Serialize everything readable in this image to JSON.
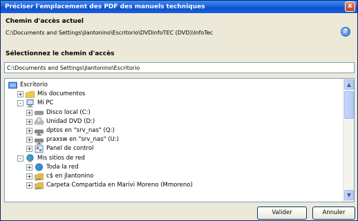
{
  "window": {
    "title": "Préciser l'emplacement des PDF des manuels techniques",
    "close_label": "x"
  },
  "current_path": {
    "label": "Chemin d'accès actuel",
    "value": "C:\\Documents and Settings\\jlantonino\\Escritorio\\DVDinfoTEC (DVD)\\InfoTec"
  },
  "select_path": {
    "label": "Sélectionnez le chemin d'accès",
    "value": "C:\\Documents and Settings\\jlantonino\\Escritorio"
  },
  "help_label": "?",
  "tree": {
    "items": [
      {
        "label": "Escritorio",
        "level": 0,
        "expander": "",
        "icon": "desktop-icon"
      },
      {
        "label": "Mis documentos",
        "level": 1,
        "expander": "+",
        "icon": "folder-icon"
      },
      {
        "label": "Mi PC",
        "level": 1,
        "expander": "-",
        "icon": "computer-icon"
      },
      {
        "label": "Disco local (C:)",
        "level": 2,
        "expander": "+",
        "icon": "hard-disk-icon"
      },
      {
        "label": "Unidad DVD (D:)",
        "level": 2,
        "expander": "+",
        "icon": "dvd-drive-icon"
      },
      {
        "label": "dptos en \"srv_nas\" (Q:)",
        "level": 2,
        "expander": "+",
        "icon": "network-drive-icon"
      },
      {
        "label": "praxsw en \"srv_nas\" (U:)",
        "level": 2,
        "expander": "+",
        "icon": "network-drive-icon"
      },
      {
        "label": "Panel de control",
        "level": 2,
        "expander": "+",
        "icon": "control-panel-icon"
      },
      {
        "label": "Mis sitios de red",
        "level": 1,
        "expander": "-",
        "icon": "network-places-icon"
      },
      {
        "label": "Toda la red",
        "level": 2,
        "expander": "+",
        "icon": "globe-icon"
      },
      {
        "label": "c$ en jlantonino",
        "level": 2,
        "expander": "+",
        "icon": "shared-folder-icon"
      },
      {
        "label": "Carpeta Compartida en Marivi Moreno (Mmoreno)",
        "level": 2,
        "expander": "+",
        "icon": "shared-folder-icon"
      }
    ]
  },
  "buttons": {
    "validate": "Valider",
    "cancel": "Annuler"
  },
  "scroll": {
    "up": "▲",
    "down": "▼"
  }
}
